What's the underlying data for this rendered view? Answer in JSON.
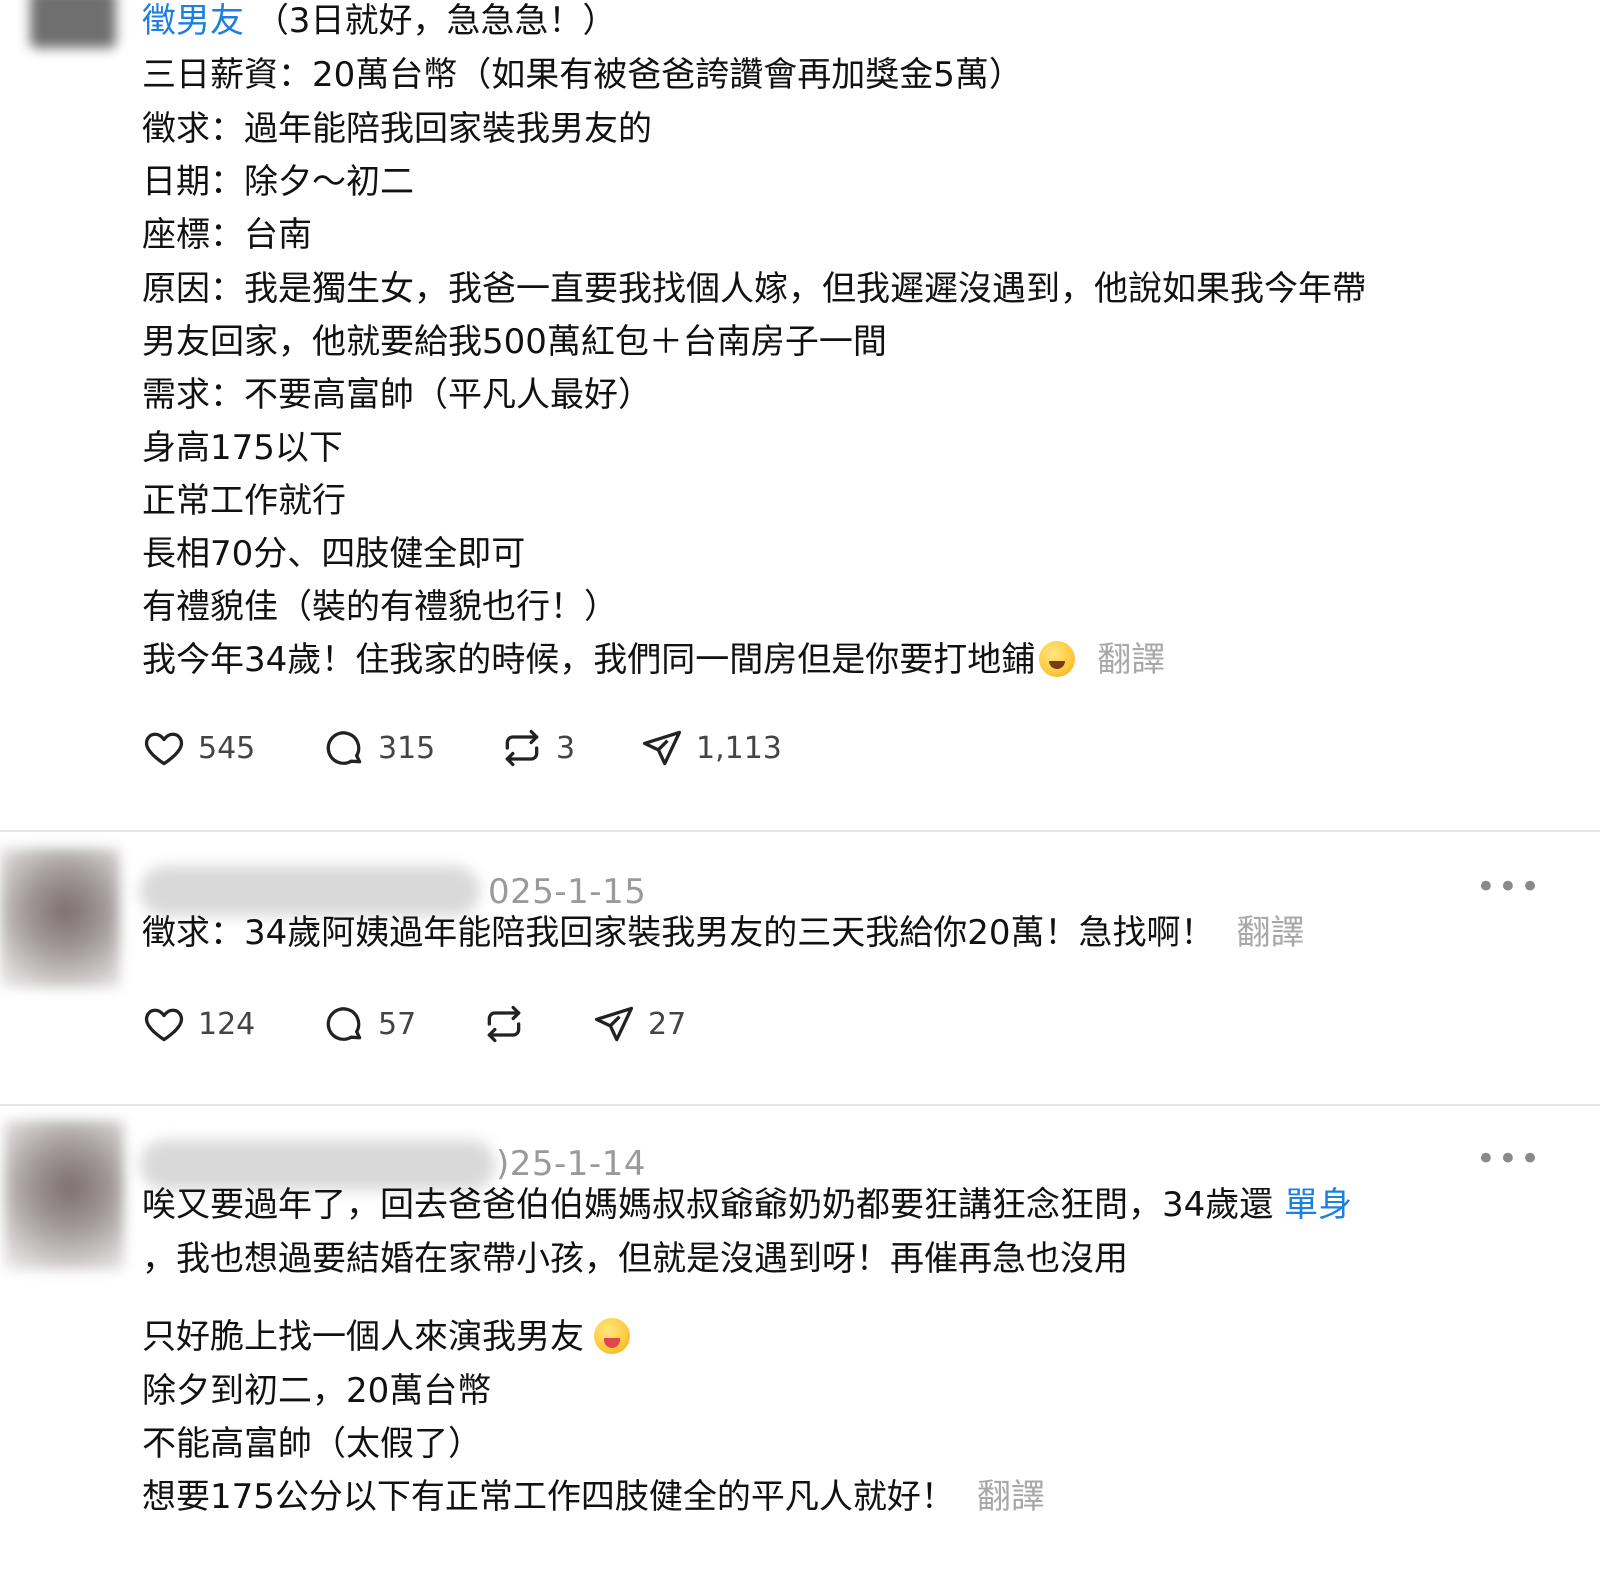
{
  "post1": {
    "title_link": "徵男友",
    "title_rest": "（3日就好，急急急！）",
    "lines": [
      "三日薪資：20萬台幣（如果有被爸爸誇讚會再加獎金5萬）",
      "徵求：過年能陪我回家裝我男友的",
      "日期：除夕～初二",
      "座標：台南",
      "原因：我是獨生女，我爸一直要我找個人嫁，但我遲遲沒遇到，他說如果我今年帶",
      "男友回家，他就要給我500萬紅包＋台南房子一間",
      "需求：不要高富帥（平凡人最好）",
      "身高175以下",
      "正常工作就行",
      "長相70分、四肢健全即可",
      "有禮貌佳（裝的有禮貌也行！）"
    ],
    "last_line": "我今年34歲！住我家的時候，我們同一間房但是你要打地鋪",
    "emoji": "laughing-tears-emoji",
    "translate": "翻譯",
    "likes": "545",
    "comments": "315",
    "reposts": "3",
    "shares": "1,113"
  },
  "post2": {
    "date": "025-1-15",
    "more": "•••",
    "text": "徵求：34歲阿姨過年能陪我回家裝我男友的三天我給你20萬！急找啊！",
    "translate": "翻譯",
    "likes": "124",
    "comments": "57",
    "reposts": "",
    "shares": "27"
  },
  "post3": {
    "date": ")25-1-14",
    "more": "•••",
    "line1": "唉又要過年了，回去爸爸伯伯媽媽叔叔爺爺奶奶都要狂講狂念狂問，34歲還",
    "line1_link": "單身",
    "line2": "，我也想過要結婚在家帶小孩，但就是沒遇到呀！再催再急也沒用",
    "line3": "只好脆上找一個人來演我男友",
    "emoji": "tongue-out-emoji",
    "line4": "除夕到初二，20萬台幣",
    "line5": "不能高富帥（太假了）",
    "line6": "想要175公分以下有正常工作四肢健全的平凡人就好！",
    "translate": "翻譯"
  },
  "colors": {
    "link": "#1d7fe0",
    "muted": "#9a9a9a",
    "text": "#111111"
  }
}
